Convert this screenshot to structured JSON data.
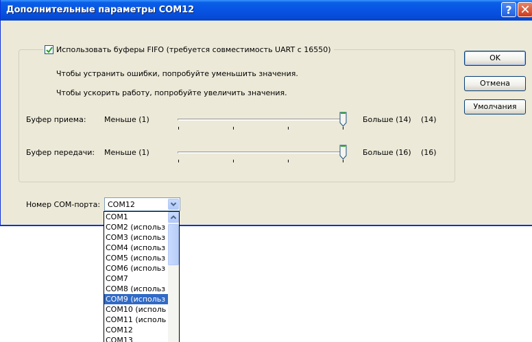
{
  "window": {
    "title": "Дополнительные параметры COM12"
  },
  "fifo": {
    "checkbox_label": "Использовать буферы FIFO (требуется совместимость UART с 16550)",
    "checked": true,
    "hint_errors": "Чтобы устранить ошибки, попробуйте уменьшить значения.",
    "hint_speed": "Чтобы ускорить работу, попробуйте увеличить значения."
  },
  "receive_buffer": {
    "label": "Буфер приема:",
    "min_label": "Меньше (1)",
    "max_label": "Больше (14)",
    "value_display": "(14)",
    "value": 14,
    "min": 1,
    "max": 14
  },
  "transmit_buffer": {
    "label": "Буфер передачи:",
    "min_label": "Меньше (1)",
    "max_label": "Больше (16)",
    "value_display": "(16)",
    "value": 16,
    "min": 1,
    "max": 16
  },
  "buttons": {
    "ok": "OK",
    "cancel": "Отмена",
    "defaults": "Умолчания"
  },
  "com_port": {
    "label": "Номер COM-порта:",
    "selected": "COM12",
    "options": [
      "COM1",
      "COM2 (использ",
      "COM3 (использ",
      "COM4 (использ",
      "COM5 (использ",
      "COM6 (использ",
      "COM7",
      "COM8 (использ",
      "COM9 (использ",
      "COM10 (исполь",
      "COM11 (исполь",
      "COM12",
      "COM13"
    ],
    "highlighted_option": "COM9 (использ"
  },
  "colors": {
    "titlebar": "#0854e3",
    "dialog_bg": "#ece9d8",
    "highlight": "#316ac5",
    "close_button": "#cd3a1d"
  },
  "icons": [
    "help-icon",
    "close-icon",
    "check-icon",
    "chevron-down-icon",
    "scroll-up-icon"
  ]
}
